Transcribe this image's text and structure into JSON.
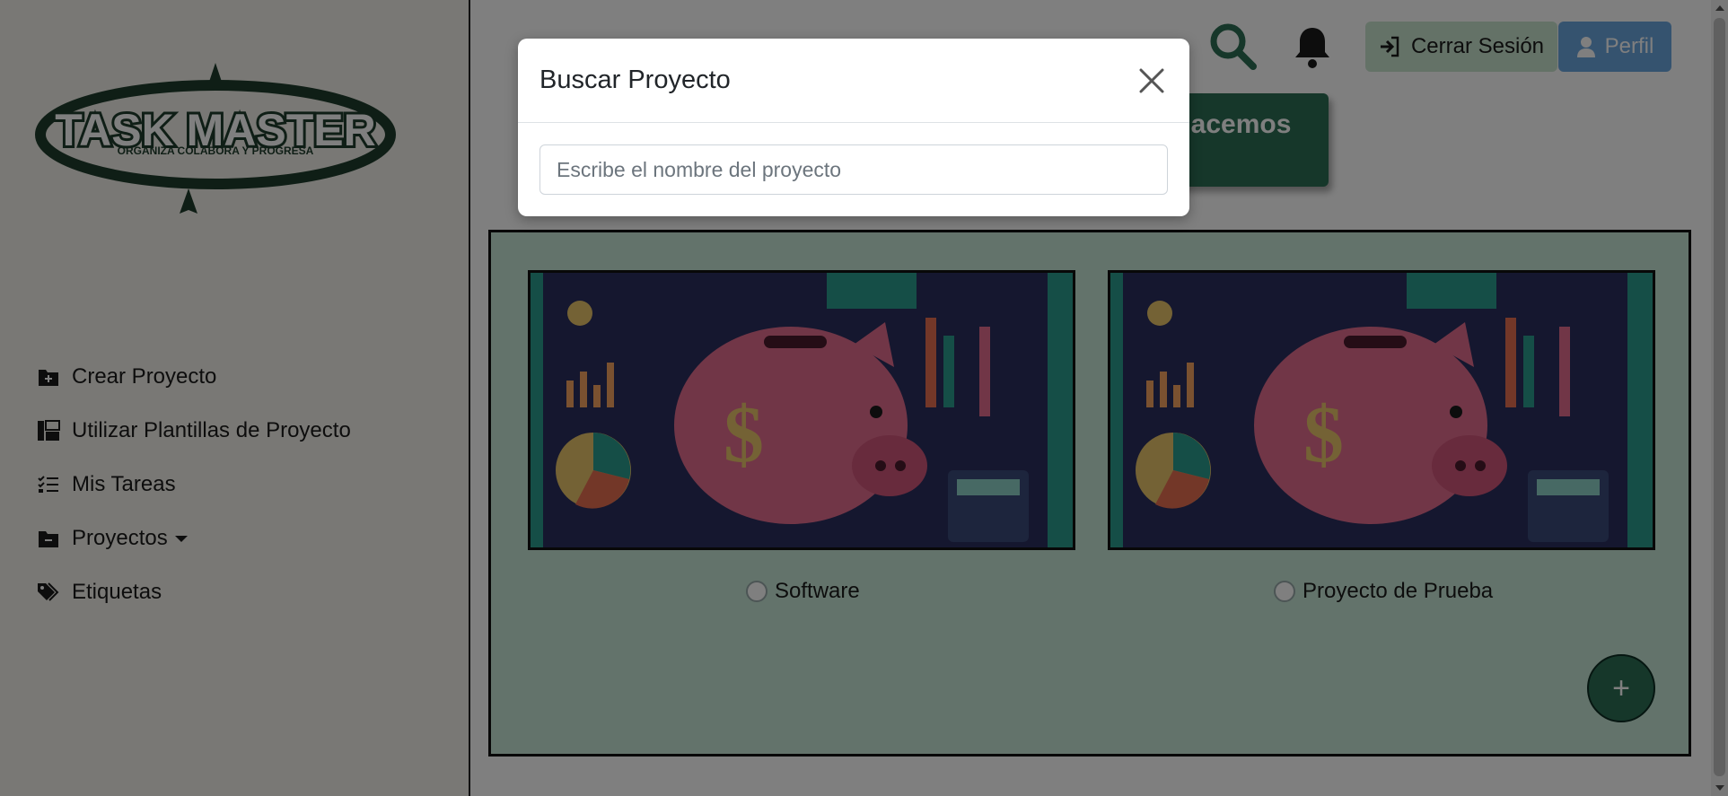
{
  "logo": {
    "title": "TASK MASTER",
    "tagline": "ORGANIZA COLABORA Y PROGRESA"
  },
  "sidebar": {
    "items": [
      {
        "label": "Crear Proyecto",
        "icon": "folder-plus-icon"
      },
      {
        "label": "Utilizar Plantillas de Proyecto",
        "icon": "template-icon"
      },
      {
        "label": "Mis Tareas",
        "icon": "task-list-icon"
      },
      {
        "label": "Proyectos",
        "icon": "folder-minus-icon"
      },
      {
        "label": "Etiquetas",
        "icon": "tags-icon"
      }
    ]
  },
  "header": {
    "logout_label": "Cerrar Sesión",
    "profile_label": "Perfil",
    "hero_text": "¿Qué Hacemos Hoy?"
  },
  "projects": [
    {
      "name": "Software",
      "image": "piggy-bank-finance-illustration"
    },
    {
      "name": "Proyecto de Prueba",
      "image": "piggy-bank-finance-illustration"
    }
  ],
  "fab": {
    "label": "+"
  },
  "modal": {
    "title": "Buscar Proyecto",
    "input_placeholder": "Escribe el nombre del proyecto",
    "input_value": ""
  },
  "colors": {
    "brand_green": "#2c6e55",
    "logout_bg": "#c9e4cf",
    "profile_bg": "#6aa6df",
    "projects_bg": "#c7e7d6",
    "sidebar_bg": "#f3f1ea"
  }
}
